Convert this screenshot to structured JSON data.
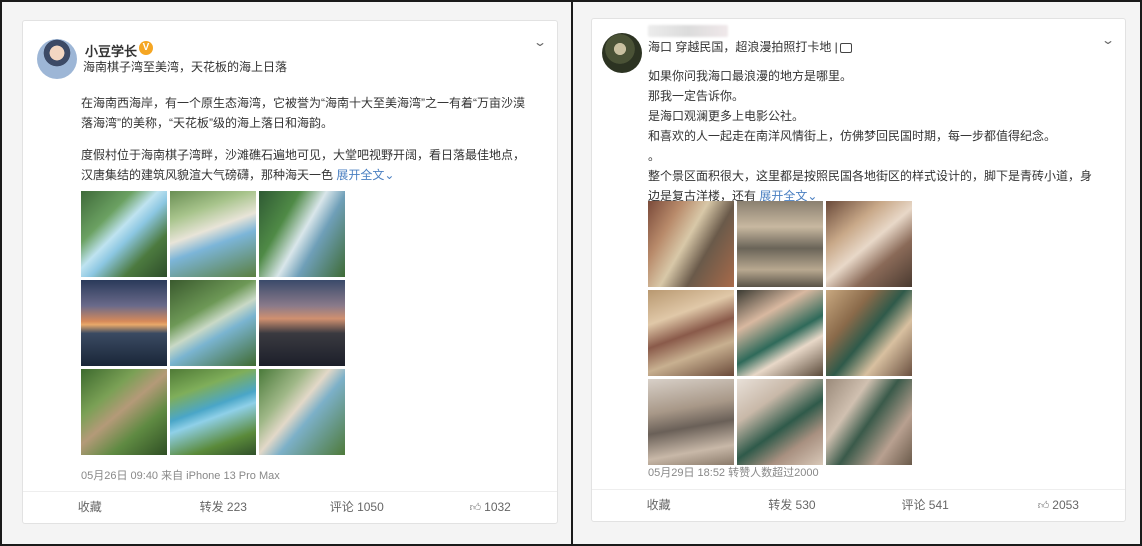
{
  "left_post": {
    "username": "小豆学长",
    "subtitle": "海南棋子湾至美湾，天花板的海上日落",
    "body": [
      "在海南西海岸，有一个原生态海湾，它被誉为“海南十大至美海湾”之一有着“万亩沙漠",
      "落海湾”的美称，“天花板”级的海上落日和海韵。",
      "度假村位于海南棋子湾畔，沙滩礁石遍地可见，大堂吧视野开阔，看日落最佳地点，",
      "汉唐集结的建筑风貌渲大气磅礴，那种海天一色 "
    ],
    "expand_label": "展开全文",
    "meta": "05月26日 09:40  来自 iPhone 13 Pro Max",
    "actions": {
      "favorite": "收藏",
      "repost": "转发 223",
      "comment": "评论 1050",
      "like": "1032"
    },
    "images": [
      "linear-gradient(135deg, #3f6a3a 0%, #6ba162 30%, #bfe3f0 45%, #8cc7e2 55%, #4c7a3f 75%, #2e4d2a 100%)",
      "linear-gradient(160deg, #6a8f54 0%, #a8c48c 25%, #e8e4d8 45%, #7cb5d8 60%, #5a7f40 100%)",
      "linear-gradient(120deg, #2f5a34 0%, #4f8a46 30%, #d9e6ea 50%, #6f9fb8 65%, #3e6b35 100%)",
      "linear-gradient(180deg, #2a3a5a 0%, #6a6a8a 30%, #d68a5a 48%, #e8a86a 52%, #3a4a62 62%, #1a2638 100%)",
      "linear-gradient(150deg, #3a5a2e 0%, #6d9856 35%, #c9d9c6 50%, #7ab4d0 62%, #3f6a30 100%)",
      "linear-gradient(180deg, #3a4a6a 0%, #8a7a8a 30%, #d09070 45%, #3a3a40 62%, #1c1f2a 100%)",
      "linear-gradient(140deg, #3d6a2e 0%, #7aa055 30%, #b49a78 48%, #5f8a42 70%, #2f4f24 100%)",
      "linear-gradient(160deg, #4f7a36 0%, #7fae5a 25%, #4aa6c8 45%, #8fd0e8 55%, #5a8a3a 80%, #30502a 100%)",
      "linear-gradient(130deg, #4a7a3a 0%, #a0b888 30%, #e2d8c8 45%, #7cb0c8 58%, #4e7a3a 100%)"
    ]
  },
  "right_post": {
    "subtitle": "海口 穿越民国，超浪漫拍照打卡地 |",
    "body": [
      "如果你问我海口最浪漫的地方是哪里。",
      "那我一定告诉你。",
      "是海口观澜更多上电影公社。",
      "和喜欢的人一起走在南洋风情街上，仿佛梦回民国时期，每一步都值得纪念。",
      "。",
      "整个景区面积很大，这里都是按照民国各地街区的样式设计的，脚下是青砖小道，身",
      "边是复古洋楼，还有 "
    ],
    "expand_label": "展开全文",
    "meta": "05月29日 18:52  转赞人数超过2000",
    "actions": {
      "favorite": "收藏",
      "repost": "转发 530",
      "comment": "评论 541",
      "like": "2053"
    },
    "images": [
      "linear-gradient(120deg, #7a4a3a 0%, #b88a6a 25%, #d8c8a8 45%, #6a5a4a 65%, #a86a4a 100%)",
      "linear-gradient(180deg, #8a8070 0%, #c8b8a0 30%, #6a6458 55%, #b8a890 80%, #5a5448 100%)",
      "linear-gradient(140deg, #6a4a3a 0%, #c8a888 30%, #e8d8c8 50%, #8a6a58 70%, #4a3a30 100%)",
      "linear-gradient(160deg, #b89870 0%, #e0c8a8 30%, #8a5a4a 50%, #c8b090 70%, #6a4a3a 100%)",
      "linear-gradient(150deg, #3a3a32 0%, #d8b8a0 30%, #2f6a5a 55%, #e8d8c8 70%, #5a4a3a 100%)",
      "linear-gradient(130deg, #c8a880 0%, #8a6a4a 30%, #2f5a4a 50%, #d8c0a0 70%, #6a5040 100%)",
      "linear-gradient(170deg, #d8d0c8 0%, #a89888 35%, #6a6058 55%, #c8b8a8 80%, #8a7a6a 100%)",
      "linear-gradient(145deg, #e8e0d8 0%, #c8b8a8 30%, #2f5a4a 55%, #a89080 75%, #d8c8b8 100%)",
      "linear-gradient(125deg, #9a8a7a 0%, #d0c0b0 30%, #3a5a4a 50%, #b8a090 75%, #6a5a4a 100%)"
    ]
  }
}
